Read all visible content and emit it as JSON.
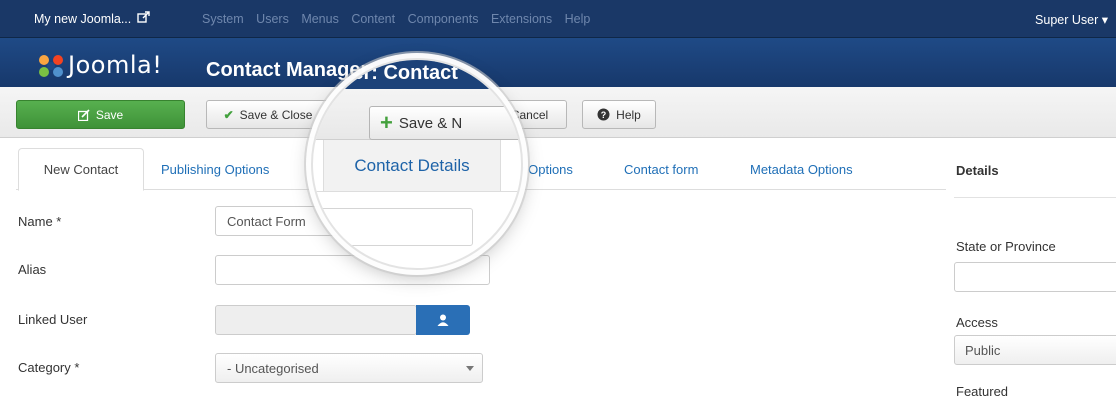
{
  "topbar": {
    "site_name": "My new Joomla...",
    "menu": [
      "System",
      "Users",
      "Menus",
      "Content",
      "Components",
      "Extensions",
      "Help"
    ],
    "user": "Super User ▾"
  },
  "header": {
    "logo_text": "Joomla!",
    "page_title": "Contact Manager: Contact"
  },
  "toolbar": {
    "save": "Save",
    "save_close": "Save & Close",
    "save_new": "Save & N",
    "cancel": "Cancel",
    "help": "Help"
  },
  "tabs": [
    "New Contact",
    "Publishing Options",
    "Contact Details",
    "Display Options",
    "Contact form",
    "Metadata Options"
  ],
  "tab_visible_fragment": "y Options",
  "form": {
    "name_label": "Name *",
    "name_value": "Contact Form",
    "alias_label": "Alias",
    "alias_value": "",
    "linked_user_label": "Linked User",
    "category_label": "Category *",
    "category_value": "- Uncategorised"
  },
  "details": {
    "heading": "Details",
    "state_label": "State or Province",
    "access_label": "Access",
    "access_value": "Public",
    "featured_label": "Featured"
  },
  "colors": {
    "topbar": "#1a3867",
    "header": "#1f4a86",
    "save_green": "#4aa043",
    "link_blue": "#1f6fb7",
    "user_button": "#2a6fb6"
  },
  "icons": {
    "external": "external-link-icon",
    "edit": "edit-icon",
    "check": "checkmark-icon",
    "plus": "plus-icon",
    "help": "help-circle-icon",
    "user": "user-icon",
    "dropdown": "chevron-down-icon"
  }
}
